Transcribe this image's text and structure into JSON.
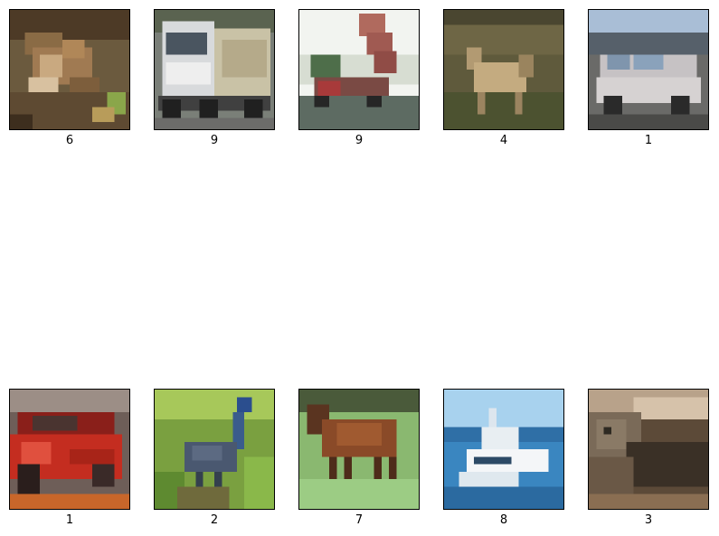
{
  "grid": {
    "labels": [
      "6",
      "9",
      "9",
      "4",
      "1",
      "1",
      "2",
      "7",
      "8",
      "3"
    ],
    "scenes": [
      "frog-scene",
      "truck-scene",
      "dump-truck-scene",
      "deer-scene",
      "car-scene",
      "red-car-scene",
      "bird-scene",
      "horse-scene",
      "boat-scene",
      "cat-scene"
    ]
  }
}
